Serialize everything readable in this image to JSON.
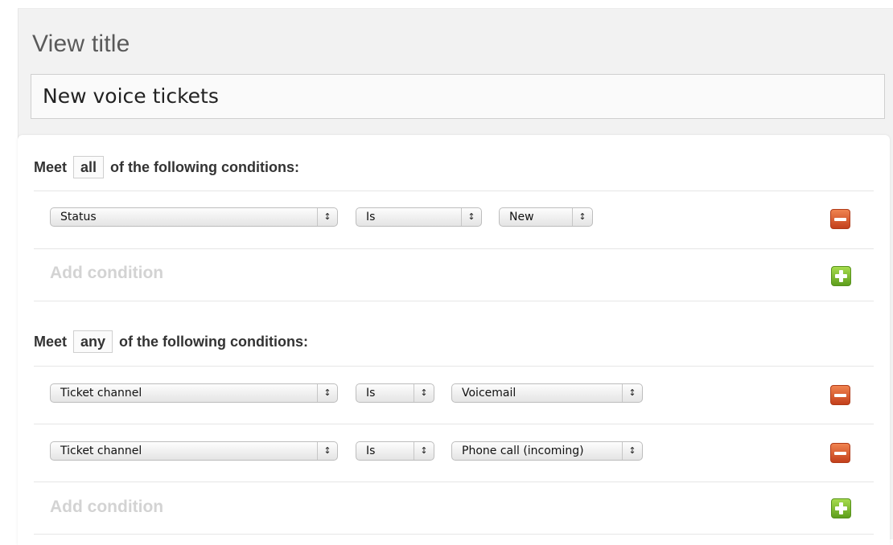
{
  "view_title": {
    "label": "View title",
    "value": "New voice tickets"
  },
  "group_all": {
    "prefix": "Meet",
    "mode": "all",
    "suffix": "of the following conditions:",
    "conditions": [
      {
        "field": "Status",
        "operator": "Is",
        "value": "New"
      }
    ],
    "add_label": "Add condition"
  },
  "group_any": {
    "prefix": "Meet",
    "mode": "any",
    "suffix": "of the following conditions:",
    "conditions": [
      {
        "field": "Ticket channel",
        "operator": "Is",
        "value": "Voicemail"
      },
      {
        "field": "Ticket channel",
        "operator": "Is",
        "value": "Phone call (incoming)"
      }
    ],
    "add_label": "Add condition"
  },
  "icons": {
    "select_arrows": "updown-arrows-icon",
    "remove": "minus-icon",
    "add": "plus-icon"
  },
  "colors": {
    "remove_button": "#d9542b",
    "add_button": "#7dbb2e",
    "placeholder_text": "#d3d3d3"
  }
}
